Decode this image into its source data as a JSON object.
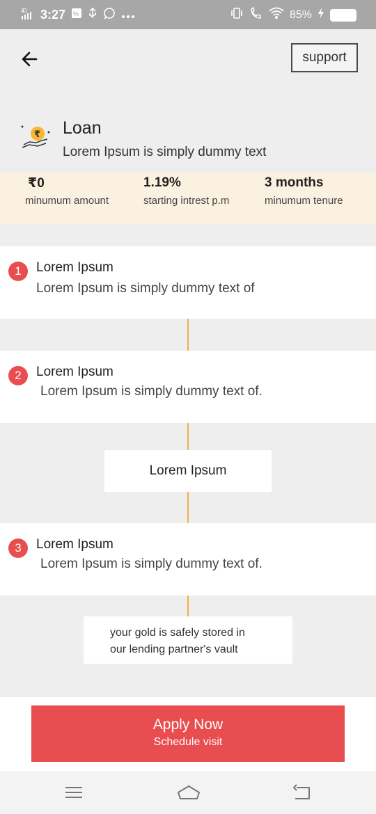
{
  "status_bar": {
    "network": "4G",
    "time": "3:27",
    "battery_percent": "85%",
    "icons": [
      "signal-icon",
      "notification-icon",
      "usb-icon",
      "whatsapp-icon",
      "more-icon",
      "vibrate-icon",
      "wifi-call-icon",
      "wifi-icon",
      "charging-icon",
      "battery-icon"
    ]
  },
  "header": {
    "support_label": "support",
    "back_icon": "back-arrow-icon"
  },
  "loan": {
    "icon": "rupee-hand-icon",
    "title": "Loan",
    "subtitle": "Lorem Ipsum is simply dummy text"
  },
  "stats": [
    {
      "value": "₹0",
      "label": "minumum amount"
    },
    {
      "value": "1.19%",
      "label": "starting intrest p.m"
    },
    {
      "value": "3 months",
      "label": "minumum tenure"
    }
  ],
  "steps": [
    {
      "number": "1",
      "title": "Lorem Ipsum",
      "description": "Lorem Ipsum is simply dummy text of"
    },
    {
      "number": "2",
      "title": "Lorem Ipsum",
      "description": "Lorem Ipsum is simply dummy text of."
    },
    {
      "number": "3",
      "title": "Lorem Ipsum",
      "description": "Lorem Ipsum is simply dummy text of."
    }
  ],
  "middle_box": "Lorem Ipsum",
  "vault_note": {
    "line1": "your gold is safely stored in",
    "line2": "our lending partner's vault"
  },
  "cta": {
    "apply_label": "Apply Now",
    "schedule_label": "Schedule visit"
  },
  "colors": {
    "accent_red": "#e84d4f",
    "timeline_orange": "#f1b24a",
    "stats_bg": "#fbf1e1",
    "page_bg": "#eeeeee"
  },
  "nav_bar": {
    "icons": [
      "menu-icon",
      "home-icon",
      "back-nav-icon"
    ]
  }
}
